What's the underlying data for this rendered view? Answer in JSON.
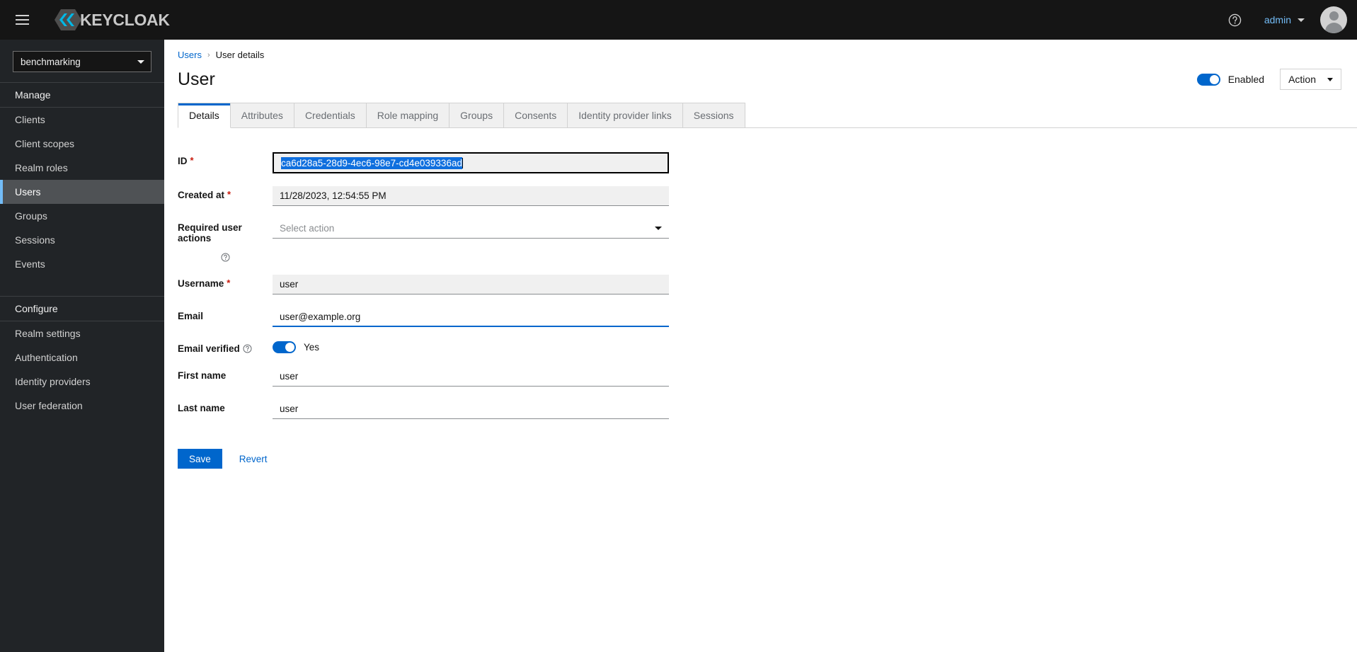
{
  "masthead": {
    "menu_icon": "hamburger-icon",
    "brand_name": "KEYCLOAK",
    "help_icon": "help-circle-icon",
    "username": "admin",
    "avatar_icon": "user-avatar-icon"
  },
  "sidebar": {
    "realm_selector": {
      "value": "benchmarking",
      "caret_icon": "chevron-down-icon"
    },
    "sections": [
      {
        "title": "Manage",
        "items": [
          {
            "label": "Clients",
            "active": false
          },
          {
            "label": "Client scopes",
            "active": false
          },
          {
            "label": "Realm roles",
            "active": false
          },
          {
            "label": "Users",
            "active": true
          },
          {
            "label": "Groups",
            "active": false
          },
          {
            "label": "Sessions",
            "active": false
          },
          {
            "label": "Events",
            "active": false
          }
        ]
      },
      {
        "title": "Configure",
        "items": [
          {
            "label": "Realm settings",
            "active": false
          },
          {
            "label": "Authentication",
            "active": false
          },
          {
            "label": "Identity providers",
            "active": false
          },
          {
            "label": "User federation",
            "active": false
          }
        ]
      }
    ]
  },
  "breadcrumb": {
    "parent": "Users",
    "separator": "›",
    "current": "User details"
  },
  "page": {
    "title": "User",
    "enabled_toggle": {
      "label": "Enabled",
      "on": true
    },
    "action_button": {
      "label": "Action",
      "caret_icon": "caret-down-icon"
    }
  },
  "tabs": [
    {
      "label": "Details",
      "active": true
    },
    {
      "label": "Attributes",
      "active": false
    },
    {
      "label": "Credentials",
      "active": false
    },
    {
      "label": "Role mapping",
      "active": false
    },
    {
      "label": "Groups",
      "active": false
    },
    {
      "label": "Consents",
      "active": false
    },
    {
      "label": "Identity provider links",
      "active": false
    },
    {
      "label": "Sessions",
      "active": false
    }
  ],
  "form": {
    "id": {
      "label": "ID",
      "required": true,
      "value": "ca6d28a5-28d9-4ec6-98e7-cd4e039336ad",
      "selected": true,
      "focused": true
    },
    "created_at": {
      "label": "Created at",
      "required": true,
      "value": "11/28/2023, 12:54:55 PM",
      "readonly": true
    },
    "required_user_actions": {
      "label": "Required user actions",
      "required": false,
      "placeholder": "Select action",
      "help_icon": "help-circle-icon",
      "caret_icon": "caret-down-icon"
    },
    "username": {
      "label": "Username",
      "required": true,
      "value": "user",
      "readonly": true
    },
    "email": {
      "label": "Email",
      "required": false,
      "value": "user@example.org"
    },
    "email_verified": {
      "label": "Email verified",
      "help_icon": "help-circle-icon",
      "on": true,
      "state_label": "Yes"
    },
    "first_name": {
      "label": "First name",
      "required": false,
      "value": "user"
    },
    "last_name": {
      "label": "Last name",
      "required": false,
      "value": "user"
    },
    "save_label": "Save",
    "revert_label": "Revert"
  },
  "colors": {
    "accent_blue": "#06c",
    "link_blue": "#73bcf7",
    "selection_blue": "#0f6fde",
    "required_red": "#c9190b",
    "masthead_bg": "#151515",
    "sidebar_bg": "#212427"
  }
}
